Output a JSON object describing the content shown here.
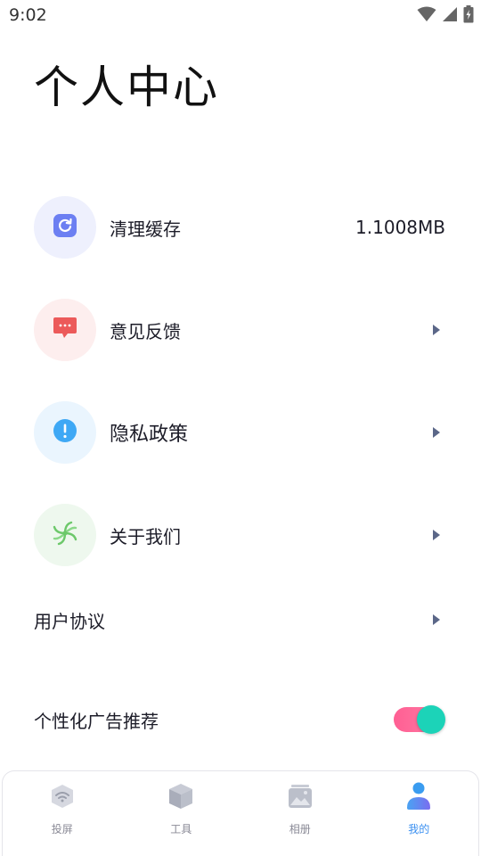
{
  "status_bar": {
    "time": "9:02"
  },
  "page": {
    "title": "个人中心"
  },
  "menu": {
    "clear_cache": {
      "label": "清理缓存",
      "value": "1.1008MB",
      "icon": "refresh-icon",
      "color": "#6c7ff2"
    },
    "feedback": {
      "label": "意见反馈",
      "icon": "chat-bubble-icon",
      "color": "#ec5a5a"
    },
    "privacy": {
      "label": "隐私政策",
      "icon": "info-icon",
      "color": "#3ea8f5"
    },
    "about": {
      "label": "关于我们",
      "icon": "swirl-logo-icon",
      "color": "#6cc86a"
    },
    "user_agreement": {
      "label": "用户协议"
    },
    "personalized_ads": {
      "label": "个性化广告推荐",
      "enabled": true
    }
  },
  "bottom_nav": {
    "items": [
      {
        "label": "投屏",
        "icon": "cast-wifi-icon",
        "active": false
      },
      {
        "label": "工具",
        "icon": "toolbox-icon",
        "active": false
      },
      {
        "label": "相册",
        "icon": "photo-album-icon",
        "active": false
      },
      {
        "label": "我的",
        "icon": "user-icon",
        "active": true
      }
    ]
  },
  "colors": {
    "active": "#3a8ff0",
    "inactive": "#8a8a96",
    "toggle_track": "#ff6b9a",
    "toggle_knob": "#1cd3b8"
  }
}
